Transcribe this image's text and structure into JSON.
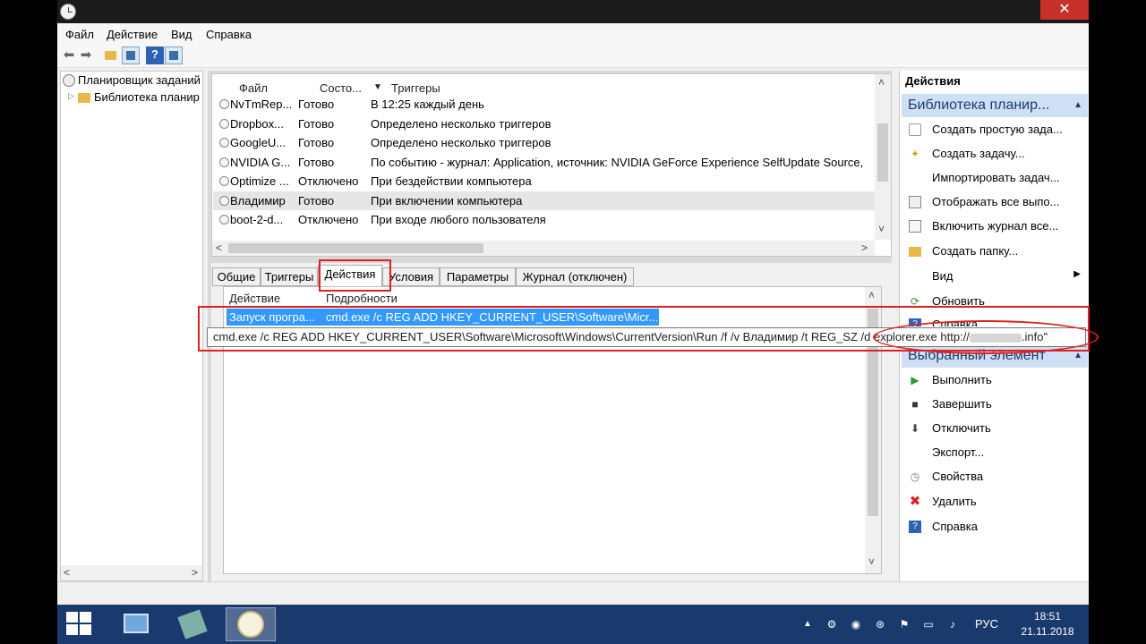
{
  "menu": [
    "Файл",
    "Действие",
    "Вид",
    "Справка"
  ],
  "tree": {
    "root": "Планировщик заданий",
    "library": "Библиотека планир"
  },
  "task_list": {
    "columns": [
      "Файл",
      "Состо...",
      "Триггеры"
    ],
    "rows": [
      {
        "name": "NvTmRep...",
        "status": "Готово",
        "trigger": "В 12:25 каждый день"
      },
      {
        "name": "Dropbox...",
        "status": "Готово",
        "trigger": "Определено несколько триггеров"
      },
      {
        "name": "GoogleU...",
        "status": "Готово",
        "trigger": "Определено несколько триггеров"
      },
      {
        "name": "NVIDIA G...",
        "status": "Готово",
        "trigger": "По событию - журнал: Application, источник: NVIDIA GeForce Experience SelfUpdate Source,"
      },
      {
        "name": "Optimize ...",
        "status": "Отключено",
        "trigger": "При бездействии компьютера"
      },
      {
        "name": "Владимир",
        "status": "Готово",
        "trigger": "При включении компьютера"
      },
      {
        "name": "boot-2-d...",
        "status": "Отключено",
        "trigger": "При входе любого пользователя"
      }
    ]
  },
  "tabs": [
    "Общие",
    "Триггеры",
    "Действия",
    "Условия",
    "Параметры",
    "Журнал (отключен)"
  ],
  "actions_tab": {
    "columns": [
      "Действие",
      "Подробности"
    ],
    "row": {
      "action": "Запуск програ...",
      "details": "cmd.exe /c REG ADD HKEY_CURRENT_USER\\Software\\Micr..."
    }
  },
  "tooltip": {
    "text_before": "cmd.exe /c REG ADD HKEY_CURRENT_USER\\Software\\Microsoft\\Windows\\CurrentVersion\\Run /f /v Владимир /t REG_SZ /d ",
    "text_url": "explorer.exe http://",
    "text_after": ".info\""
  },
  "right_pane": {
    "title": "Действия",
    "section1": "Библиотека планир...",
    "items1": [
      {
        "label": "Создать простую зада...",
        "icon": "wizard-icon"
      },
      {
        "label": "Создать задачу...",
        "icon": "new-task-icon"
      },
      {
        "label": "Импортировать задач...",
        "icon": ""
      },
      {
        "label": "Отображать все выпо...",
        "icon": "list-icon"
      },
      {
        "label": "Включить журнал все...",
        "icon": "log-icon"
      },
      {
        "label": "Создать папку...",
        "icon": "folder-icon"
      },
      {
        "label": "Вид",
        "icon": ""
      },
      {
        "label": "Обновить",
        "icon": "refresh-icon"
      },
      {
        "label": "Справка",
        "icon": "help-icon"
      }
    ],
    "section2": "Выбранный элемент",
    "items2": [
      {
        "label": "Выполнить",
        "icon": "run-icon"
      },
      {
        "label": "Завершить",
        "icon": "stop-icon"
      },
      {
        "label": "Отключить",
        "icon": "disable-icon"
      },
      {
        "label": "Экспорт...",
        "icon": ""
      },
      {
        "label": "Свойства",
        "icon": "properties-icon"
      },
      {
        "label": "Удалить",
        "icon": "delete-icon"
      },
      {
        "label": "Справка",
        "icon": "help-icon"
      }
    ]
  },
  "taskbar": {
    "lang": "РУС",
    "time": "18:51",
    "date": "21.11.2018"
  },
  "colors": {
    "selection": "#3399ff",
    "annotation": "#e02020",
    "taskbar": "#1a3a6e",
    "section_header": "#cfe0f5"
  }
}
